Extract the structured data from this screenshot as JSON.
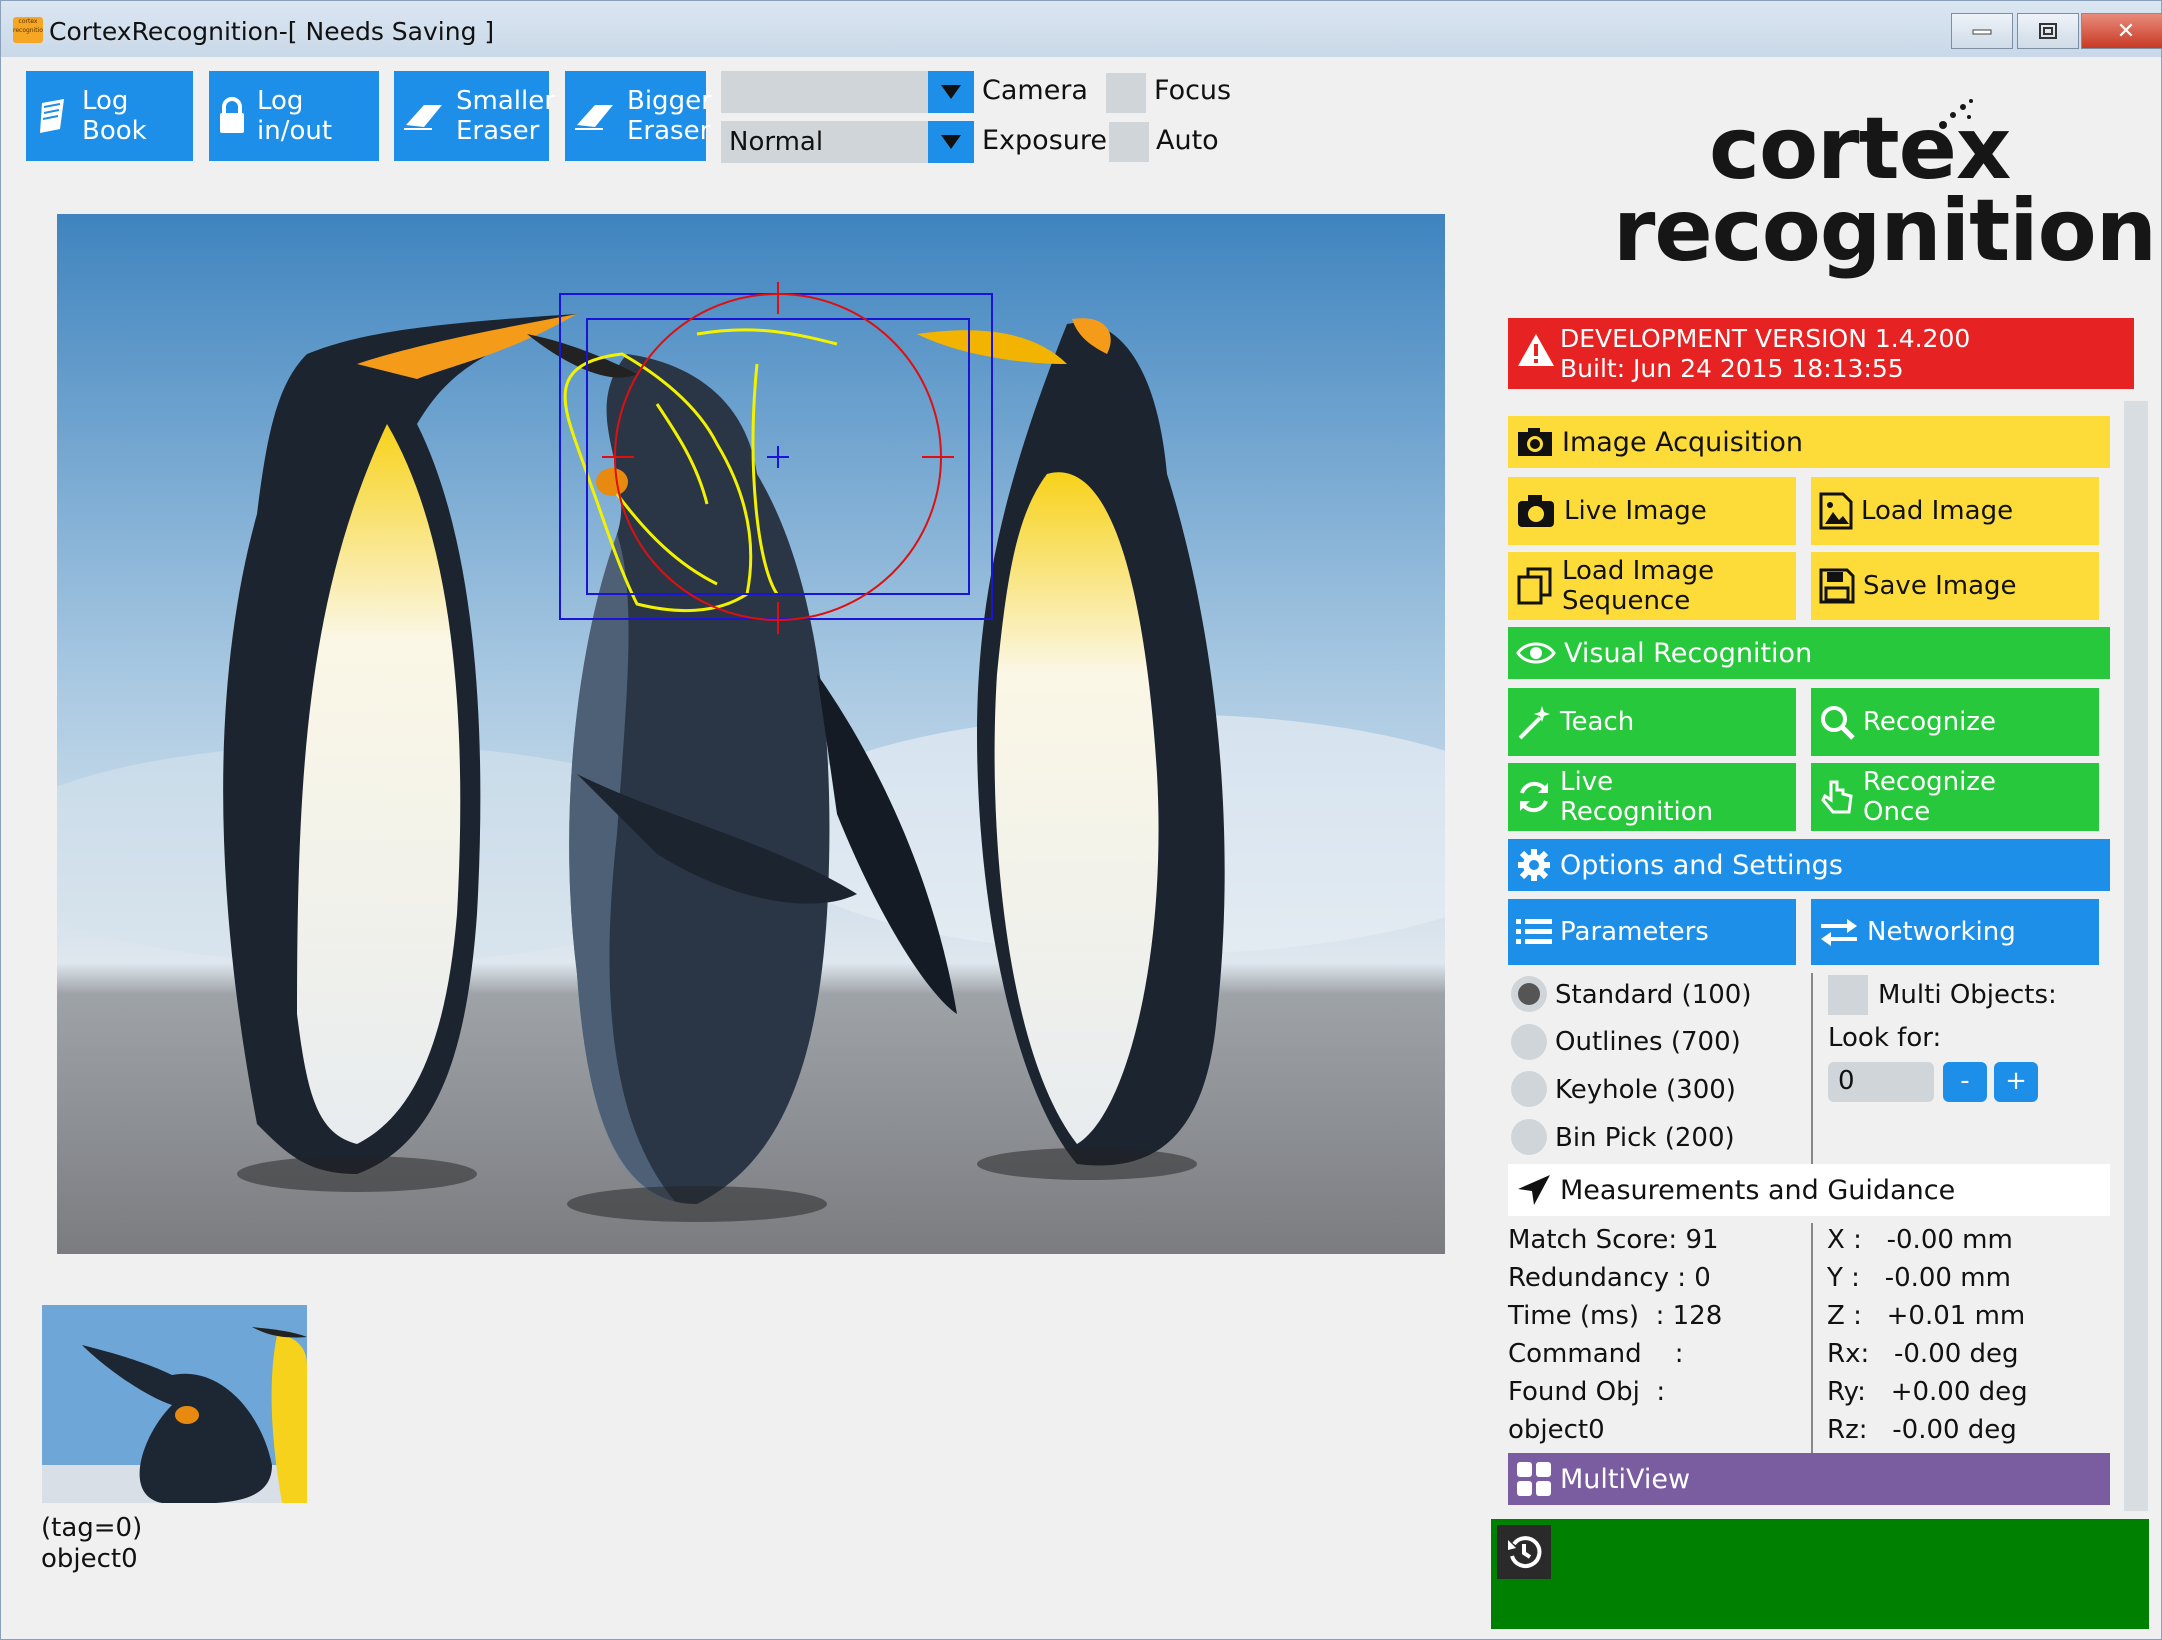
{
  "window": {
    "title": "CortexRecognition-[ Needs Saving ]",
    "app_icon_text": "cortex recognition",
    "close_glyph": "✕"
  },
  "toolbar": {
    "log_book": "Log Book",
    "log_in_out": "Log in/out",
    "smaller_eraser": [
      "Smaller",
      "Eraser"
    ],
    "bigger_eraser": [
      "Bigger",
      "Eraser"
    ]
  },
  "camera": {
    "camera_value": "",
    "camera_label": "Camera",
    "exposure_value": "Normal",
    "exposure_label": "Exposure",
    "focus_label": "Focus",
    "auto_label": "Auto"
  },
  "logo": {
    "line1": "cortex",
    "line2": "recognition"
  },
  "dev": {
    "line1": "DEVELOPMENT VERSION 1.4.200",
    "line2": "Built: Jun 24 2015 18:13:55"
  },
  "acquisition": {
    "header": "Image Acquisition",
    "live_image": "Live Image",
    "load_image": "Load Image",
    "load_sequence": [
      "Load Image",
      "Sequence"
    ],
    "save_image": "Save Image"
  },
  "visual": {
    "header": "Visual Recognition",
    "teach": "Teach",
    "recognize": "Recognize",
    "live_recognition": [
      "Live",
      "Recognition"
    ],
    "recognize_once": [
      "Recognize",
      "Once"
    ]
  },
  "options": {
    "header": "Options and Settings",
    "parameters": "Parameters",
    "networking": "Networking"
  },
  "modes": [
    {
      "label": "Standard (100)",
      "selected": true
    },
    {
      "label": "Outlines (700)",
      "selected": false
    },
    {
      "label": "Keyhole  (300)",
      "selected": false
    },
    {
      "label": "Bin Pick (200)",
      "selected": false
    }
  ],
  "multi": {
    "label": "Multi Objects:",
    "look_for": "Look for:",
    "value": "0",
    "minus": "-",
    "plus": "+"
  },
  "measure": {
    "header": "Measurements and Guidance",
    "left": [
      "Match Score: 91",
      "Redundancy : 0",
      "Time (ms)  : 128",
      "Command    :",
      "Found Obj  :",
      "object0"
    ],
    "right": [
      "X :   -0.00 mm",
      "Y :   -0.00 mm",
      "Z :   +0.01 mm",
      "Rx:   -0.00 deg",
      "Ry:   +0.00 deg",
      "Rz:   -0.00 deg"
    ]
  },
  "multiview": {
    "header": "MultiView"
  },
  "thumb": {
    "tag": "(tag=0)",
    "name": "object0"
  },
  "colors": {
    "blue": "#1e8fe8",
    "yellow": "#fddc3a",
    "green": "#28c83c",
    "red": "#e62222",
    "purple": "#7a5ca0",
    "footer": "#008000"
  }
}
